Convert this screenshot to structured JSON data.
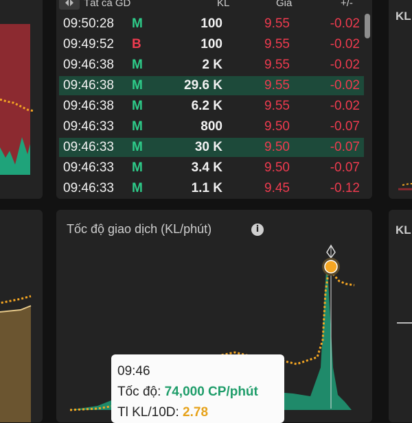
{
  "trade_table": {
    "headers": {
      "all_label": "Tất cả GD",
      "vol": "KL",
      "price": "Giá",
      "change": "+/-"
    },
    "rows": [
      {
        "time": "09:50:28",
        "side": "M",
        "vol": "100",
        "price": "9.55",
        "change": "-0.02",
        "highlight": false
      },
      {
        "time": "09:49:52",
        "side": "B",
        "vol": "100",
        "price": "9.55",
        "change": "-0.02",
        "highlight": false
      },
      {
        "time": "09:46:38",
        "side": "M",
        "vol": "2 K",
        "price": "9.55",
        "change": "-0.02",
        "highlight": false
      },
      {
        "time": "09:46:38",
        "side": "M",
        "vol": "29.6 K",
        "price": "9.55",
        "change": "-0.02",
        "highlight": true
      },
      {
        "time": "09:46:38",
        "side": "M",
        "vol": "6.2 K",
        "price": "9.55",
        "change": "-0.02",
        "highlight": false
      },
      {
        "time": "09:46:33",
        "side": "M",
        "vol": "800",
        "price": "9.50",
        "change": "-0.07",
        "highlight": false
      },
      {
        "time": "09:46:33",
        "side": "M",
        "vol": "30 K",
        "price": "9.50",
        "change": "-0.07",
        "highlight": true
      },
      {
        "time": "09:46:33",
        "side": "M",
        "vol": "3.4 K",
        "price": "9.50",
        "change": "-0.07",
        "highlight": false
      },
      {
        "time": "09:46:33",
        "side": "M",
        "vol": "1.1 K",
        "price": "9.45",
        "change": "-0.12",
        "highlight": false
      }
    ]
  },
  "speed_chart": {
    "title": "Tốc độ giao dịch (KL/phút)",
    "info_icon": "info-icon",
    "tooltip": {
      "time": "09:46",
      "speed_label": "Tốc độ:",
      "speed_value": "74,000 CP/phút",
      "ratio_label": "Tl KL/10D:",
      "ratio_value": "2.78"
    }
  },
  "right_panels": {
    "top_label": "KL",
    "bottom_label": "KL"
  },
  "colors": {
    "buy": "#2ecc8a",
    "sell": "#ef3b4f",
    "highlight": "#1d4a3a",
    "accent": "#f5a623",
    "bg": "#121212",
    "panel": "#232323"
  }
}
